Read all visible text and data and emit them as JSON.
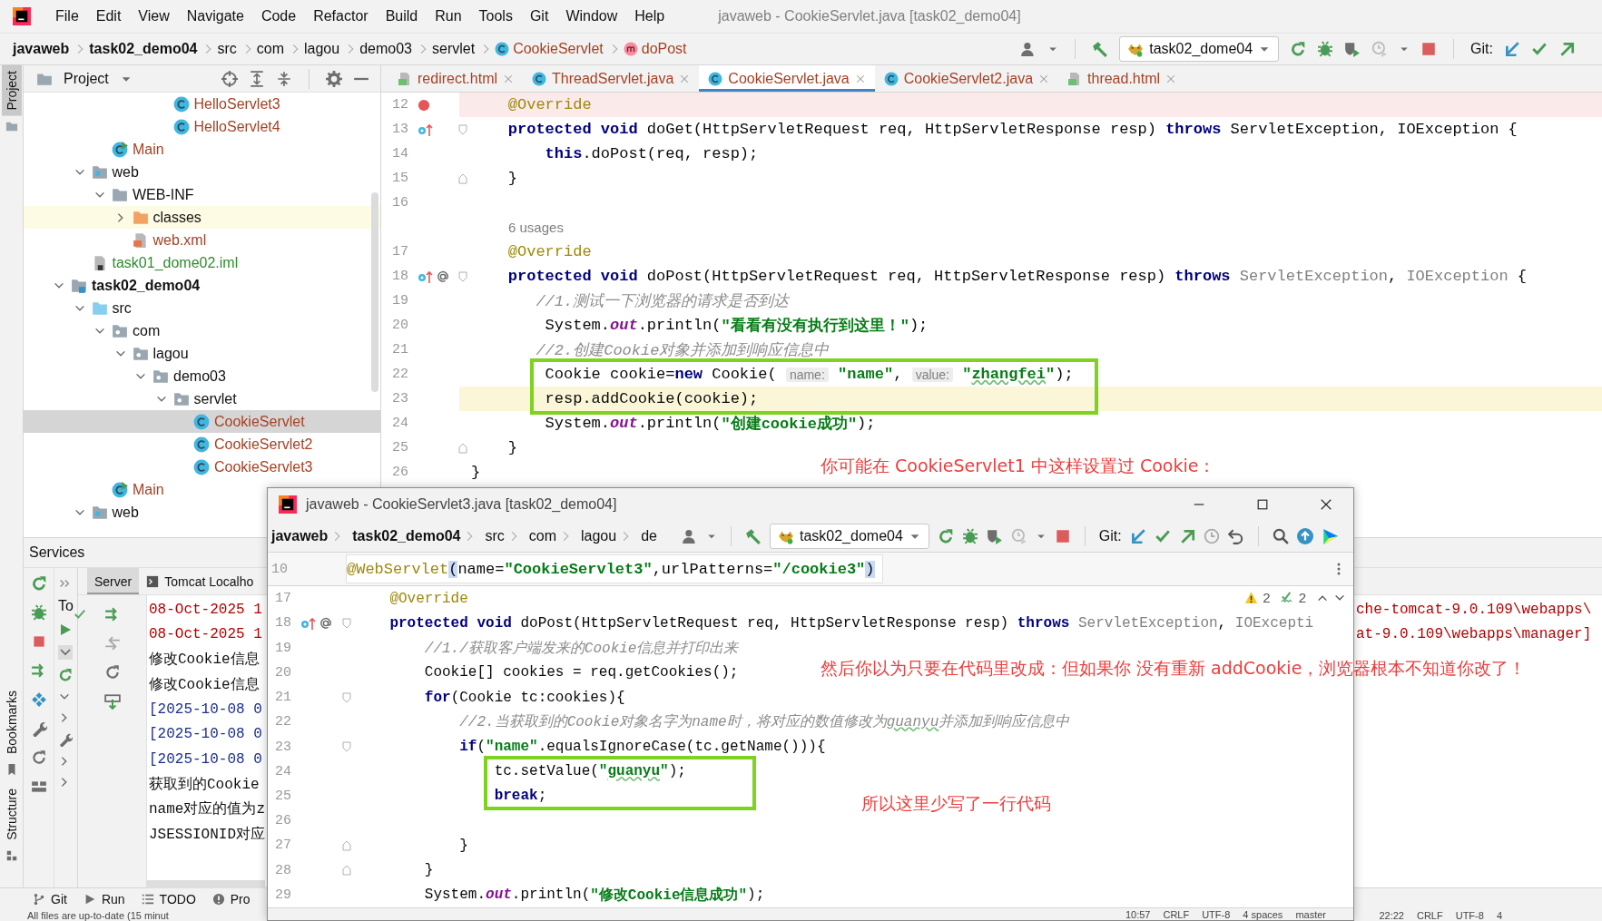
{
  "menu_bar": {
    "items": [
      "File",
      "Edit",
      "View",
      "Navigate",
      "Code",
      "Refactor",
      "Build",
      "Run",
      "Tools",
      "Git",
      "Window",
      "Help"
    ],
    "title": "javaweb - CookieServlet.java [task02_demo04]"
  },
  "nav_bar": {
    "breadcrumbs": [
      {
        "label": "javaweb",
        "kind": "project"
      },
      {
        "label": "task02_demo04",
        "kind": "module"
      },
      {
        "label": "src",
        "kind": "dir"
      },
      {
        "label": "com",
        "kind": "dir"
      },
      {
        "label": "lagou",
        "kind": "dir"
      },
      {
        "label": "demo03",
        "kind": "dir"
      },
      {
        "label": "servlet",
        "kind": "dir"
      },
      {
        "label": "CookieServlet",
        "kind": "class"
      },
      {
        "label": "doPost",
        "kind": "method"
      }
    ],
    "run_config": "task02_dome04",
    "git_label": "Git:"
  },
  "side_strip": {
    "top": [
      {
        "label": "Project",
        "selected": true
      }
    ],
    "bottom": [
      {
        "label": "Bookmarks",
        "selected": false
      },
      {
        "label": "Structure",
        "selected": false
      }
    ]
  },
  "project_panel": {
    "title": "Project",
    "tree": [
      {
        "children": [
          {
            "children": [
              {
                "children": [
                  {
                    "children": [
                      {
                        "children": [
                          {
                            "label": "HelloServlet3",
                            "kind": "class",
                            "color": "#a64124",
                            "selected": false,
                            "highlighted": false
                          },
                          {
                            "label": "HelloServlet4",
                            "kind": "class",
                            "color": "#a64124",
                            "selected": false,
                            "highlighted": false
                          }
                        ]
                      }
                    ]
                  }
                ]
              },
              {
                "label": "Main",
                "kind": "main",
                "color": "#a64124",
                "selected": false,
                "highlighted": false
              }
            ]
          },
          {
            "label": "web",
            "kind": "web-folder",
            "color": "#111111",
            "expanded": true,
            "selected": false,
            "highlighted": false,
            "children": [
              {
                "label": "WEB-INF",
                "kind": "folder",
                "color": "#111111",
                "expanded": true,
                "selected": false,
                "highlighted": false,
                "children": [
                  {
                    "label": "classes",
                    "kind": "excluded-folder",
                    "color": "#111111",
                    "expanded": false,
                    "selected": false,
                    "highlighted": true
                  },
                  {
                    "label": "web.xml",
                    "kind": "xml",
                    "color": "#a64124",
                    "selected": false,
                    "highlighted": false
                  }
                ]
              }
            ]
          },
          {
            "label": "task01_dome02.iml",
            "kind": "iml",
            "color": "#2e8b2e",
            "selected": false,
            "highlighted": false
          }
        ]
      },
      {
        "label": "task02_demo04",
        "kind": "module",
        "color": "#111111",
        "expanded": true,
        "selected": false,
        "highlighted": false,
        "children": [
          {
            "label": "src",
            "kind": "source-folder",
            "color": "#111111",
            "expanded": true,
            "selected": false,
            "highlighted": false,
            "children": [
              {
                "label": "com",
                "kind": "package",
                "color": "#111111",
                "expanded": true,
                "selected": false,
                "highlighted": false,
                "children": [
                  {
                    "label": "lagou",
                    "kind": "package",
                    "color": "#111111",
                    "expanded": true,
                    "selected": false,
                    "highlighted": false,
                    "children": [
                      {
                        "label": "demo03",
                        "kind": "package",
                        "color": "#111111",
                        "expanded": true,
                        "selected": false,
                        "highlighted": false,
                        "children": [
                          {
                            "label": "servlet",
                            "kind": "package",
                            "color": "#111111",
                            "expanded": true,
                            "selected": false,
                            "highlighted": false,
                            "children": [
                              {
                                "label": "CookieServlet",
                                "kind": "class",
                                "color": "#a64124",
                                "selected": true,
                                "highlighted": false
                              },
                              {
                                "label": "CookieServlet2",
                                "kind": "class",
                                "color": "#a64124",
                                "selected": false,
                                "highlighted": false
                              },
                              {
                                "label": "CookieServlet3",
                                "kind": "class",
                                "color": "#a64124",
                                "selected": false,
                                "highlighted": false
                              }
                            ]
                          }
                        ]
                      }
                    ]
                  }
                ]
              },
              {
                "label": "Main",
                "kind": "main",
                "color": "#a64124",
                "selected": false,
                "highlighted": false
              }
            ]
          },
          {
            "label": "web",
            "kind": "web-folder",
            "color": "#111111",
            "expanded": true,
            "selected": false,
            "highlighted": false
          }
        ]
      }
    ]
  },
  "editor": {
    "tabs": [
      {
        "label": "redirect.html",
        "kind": "html",
        "selected": false
      },
      {
        "label": "ThreadServlet.java",
        "kind": "class",
        "selected": false
      },
      {
        "label": "CookieServlet.java",
        "kind": "class",
        "selected": true
      },
      {
        "label": "CookieServlet2.java",
        "kind": "class",
        "selected": false
      },
      {
        "label": "thread.html",
        "kind": "html",
        "selected": false
      }
    ],
    "lines": [
      {
        "kind": "code",
        "number": "12",
        "gutter": [
          {
            "kind": "breakpoint"
          }
        ],
        "current": false,
        "tokens": [
          {
            "kind": "ann",
            "text": "    @Override"
          }
        ]
      },
      {
        "kind": "code",
        "number": "13",
        "gutter": [
          {
            "kind": "override"
          }
        ],
        "fold": {
          "kind": "start"
        },
        "current": false,
        "tokens": [
          {
            "kind": "kw",
            "text": "    protected void "
          },
          {
            "kind": "p",
            "text": "doGet(HttpServletRequest req, HttpServletResponse resp) "
          },
          {
            "kind": "kw",
            "text": "throws "
          },
          {
            "kind": "p",
            "text": "ServletException, IOException {"
          }
        ]
      },
      {
        "kind": "code",
        "number": "14",
        "current": false,
        "tokens": [
          {
            "kind": "kw",
            "text": "        this"
          },
          {
            "kind": "p",
            "text": ".doPost(req, resp);"
          }
        ]
      },
      {
        "kind": "code",
        "number": "15",
        "fold": {
          "kind": "end"
        },
        "current": false,
        "tokens": [
          {
            "kind": "p",
            "text": "    }"
          }
        ]
      },
      {
        "kind": "code",
        "number": "16",
        "current": false
      },
      {
        "kind": "usages",
        "text": "6 usages",
        "current": false
      },
      {
        "kind": "code",
        "number": "17",
        "current": false,
        "tokens": [
          {
            "kind": "ann",
            "text": "    @Override"
          }
        ]
      },
      {
        "kind": "code",
        "number": "18",
        "gutter": [
          {
            "kind": "override"
          },
          {
            "kind": "annotation"
          }
        ],
        "fold": {
          "kind": "start"
        },
        "current": false,
        "tokens": [
          {
            "kind": "kw",
            "text": "    protected void "
          },
          {
            "kind": "p",
            "text": "doPost(HttpServletRequest req, HttpServletResponse resp) "
          },
          {
            "kind": "kw",
            "text": "throws "
          },
          {
            "kind": "dim",
            "text": "ServletException"
          },
          {
            "kind": "p",
            "text": ", "
          },
          {
            "kind": "dim",
            "text": "IOException"
          },
          {
            "kind": "p",
            "text": " {"
          }
        ]
      },
      {
        "kind": "code",
        "number": "19",
        "current": false,
        "tokens": [
          {
            "kind": "cm",
            "text": "       //1.测试一下浏览器的请求是否到达"
          }
        ]
      },
      {
        "kind": "code",
        "number": "20",
        "current": false,
        "tokens": [
          {
            "kind": "p",
            "text": "        System."
          },
          {
            "kind": "field",
            "text": "out"
          },
          {
            "kind": "p",
            "text": ".println("
          },
          {
            "kind": "str",
            "text": "\"看看有没有执行到这里！\""
          },
          {
            "kind": "p",
            "text": ");"
          }
        ]
      },
      {
        "kind": "code",
        "number": "21",
        "current": false,
        "tokens": [
          {
            "kind": "cm",
            "text": "       //2.创建Cookie对象并添加到响应信息中"
          }
        ]
      },
      {
        "kind": "code",
        "number": "22",
        "current": false,
        "tokens": [
          {
            "kind": "p",
            "text": "        Cookie cookie="
          },
          {
            "kind": "kw",
            "text": "new "
          },
          {
            "kind": "p",
            "text": "Cookie( "
          },
          {
            "kind": "hint",
            "text": "name:"
          },
          {
            "kind": "str",
            "text": " \"name\""
          },
          {
            "kind": "p",
            "text": ", "
          },
          {
            "kind": "hint",
            "text": "value:"
          },
          {
            "kind": "str",
            "text": " \""
          },
          {
            "kind": "typo",
            "text": "zhangfei"
          },
          {
            "kind": "str",
            "text": "\""
          },
          {
            "kind": "p",
            "text": ");"
          }
        ]
      },
      {
        "kind": "code",
        "number": "23",
        "current": true,
        "tokens": [
          {
            "kind": "p",
            "text": "        resp.addCookie(cookie);"
          }
        ]
      },
      {
        "kind": "code",
        "number": "24",
        "current": false,
        "tokens": [
          {
            "kind": "p",
            "text": "        System."
          },
          {
            "kind": "field",
            "text": "out"
          },
          {
            "kind": "p",
            "text": ".println("
          },
          {
            "kind": "str",
            "text": "\"创建cookie成功\""
          },
          {
            "kind": "p",
            "text": ");"
          }
        ]
      },
      {
        "kind": "code",
        "number": "25",
        "fold": {
          "kind": "end"
        },
        "current": false,
        "tokens": [
          {
            "kind": "p",
            "text": "    }"
          }
        ]
      },
      {
        "kind": "code",
        "number": "26",
        "current": false,
        "tokens": [
          {
            "kind": "p",
            "text": "}"
          }
        ]
      }
    ]
  },
  "services": {
    "title": "Services",
    "tabs": [
      {
        "label": "Server",
        "selected": true
      },
      {
        "label": "Tomcat Localho",
        "selected": false
      }
    ],
    "tree_item": "To",
    "console": [
      {
        "kind": "err",
        "text": "08-Oct-2025 1",
        "tail": "che-tomcat-9.0.109\\webapps\\"
      },
      {
        "kind": "err",
        "text": "08-Oct-2025 1",
        "tail": "at-9.0.109\\webapps\\manager]"
      },
      {
        "kind": "out",
        "text": "修改Cookie信息"
      },
      {
        "kind": "out",
        "text": "修改Cookie信息"
      },
      {
        "kind": "info",
        "text": "[2025-10-08 0"
      },
      {
        "kind": "info",
        "text": "[2025-10-08 0"
      },
      {
        "kind": "info",
        "text": "[2025-10-08 0"
      },
      {
        "kind": "out",
        "text": "获取到的Cookie"
      },
      {
        "kind": "out",
        "text": "name对应的值为z"
      },
      {
        "kind": "out",
        "text": "JSESSIONID对应"
      }
    ]
  },
  "bottom_tools": [
    {
      "label": "Git",
      "kind": "git"
    },
    {
      "label": "Run",
      "kind": "run"
    },
    {
      "label": "TODO",
      "kind": "todo"
    },
    {
      "label": "Pro",
      "kind": "problems"
    }
  ],
  "status_bar": {
    "message": "All files are up-to-date (15 minut",
    "items": [
      "22:22",
      "CRLF",
      "UTF-8",
      "4"
    ]
  },
  "float_window": {
    "title": "javaweb - CookieServlet3.java [task02_demo04]",
    "breadcrumbs": [
      {
        "label": "javaweb",
        "kind": "project"
      },
      {
        "label": "task02_demo04",
        "kind": "module"
      },
      {
        "label": "src",
        "kind": "dir"
      },
      {
        "label": "com",
        "kind": "dir"
      },
      {
        "label": "lagou",
        "kind": "dir"
      },
      {
        "label": "de",
        "kind": "dir"
      }
    ],
    "run_config": "task02_dome04",
    "git_label": "Git:",
    "sticky_line": {
      "number": "10",
      "tokens": [
        {
          "kind": "ann",
          "text": "@WebServlet"
        },
        {
          "kind": "brace",
          "text": "("
        },
        {
          "kind": "p",
          "text": "name="
        },
        {
          "kind": "str",
          "text": "\"CookieServlet3\""
        },
        {
          "kind": "p",
          "text": ",urlPatterns="
        },
        {
          "kind": "str",
          "text": "\"/cookie3\""
        },
        {
          "kind": "brace",
          "text": ")"
        }
      ]
    },
    "inspections": {
      "warnings": "2",
      "checks": "2"
    },
    "lines": [
      {
        "kind": "code",
        "number": "17",
        "tokens": [
          {
            "kind": "ann",
            "text": "    @Override"
          }
        ]
      },
      {
        "kind": "code",
        "number": "18",
        "gutter": [
          {
            "kind": "override"
          },
          {
            "kind": "annotation"
          }
        ],
        "fold": {
          "kind": "start"
        },
        "tokens": [
          {
            "kind": "kw",
            "text": "    protected void "
          },
          {
            "kind": "p",
            "text": "doPost(HttpServletRequest req, HttpServletResponse resp) "
          },
          {
            "kind": "kw",
            "text": "throws "
          },
          {
            "kind": "dim",
            "text": "ServletException"
          },
          {
            "kind": "p",
            "text": ", "
          },
          {
            "kind": "dim",
            "text": "IOExcepti"
          }
        ]
      },
      {
        "kind": "code",
        "number": "19",
        "tokens": [
          {
            "kind": "cm",
            "text": "        //1./获取客户端发来的Cookie信息并打印出来"
          }
        ]
      },
      {
        "kind": "code",
        "number": "20",
        "tokens": [
          {
            "kind": "p",
            "text": "        Cookie[] cookies = req.getCookies();"
          }
        ]
      },
      {
        "kind": "code",
        "number": "21",
        "fold": {
          "kind": "start"
        },
        "tokens": [
          {
            "kind": "kw",
            "text": "        for"
          },
          {
            "kind": "p",
            "text": "(Cookie tc:cookies){"
          }
        ]
      },
      {
        "kind": "code",
        "number": "22",
        "tokens": [
          {
            "kind": "cm",
            "text": "            //2.当获取到的Cookie对象名字为name时，将对应的数值修改为"
          },
          {
            "kind": "cm-typo",
            "text": "guanyu"
          },
          {
            "kind": "cm",
            "text": "并添加到响应信息中"
          }
        ]
      },
      {
        "kind": "code",
        "number": "23",
        "fold": {
          "kind": "start"
        },
        "tokens": [
          {
            "kind": "kw",
            "text": "            if"
          },
          {
            "kind": "p",
            "text": "("
          },
          {
            "kind": "str",
            "text": "\"name\""
          },
          {
            "kind": "p",
            "text": ".equalsIgnoreCase(tc.getName())){"
          }
        ]
      },
      {
        "kind": "code",
        "number": "24",
        "tokens": [
          {
            "kind": "p",
            "text": "                tc.setValue("
          },
          {
            "kind": "str",
            "text": "\""
          },
          {
            "kind": "typo",
            "text": "guanyu"
          },
          {
            "kind": "str",
            "text": "\""
          },
          {
            "kind": "p",
            "text": ");"
          }
        ]
      },
      {
        "kind": "code",
        "number": "25",
        "tokens": [
          {
            "kind": "kw",
            "text": "                break"
          },
          {
            "kind": "p",
            "text": ";"
          }
        ]
      },
      {
        "kind": "code",
        "number": "26"
      },
      {
        "kind": "code",
        "number": "27",
        "fold": {
          "kind": "end"
        },
        "tokens": [
          {
            "kind": "p",
            "text": "            }"
          }
        ]
      },
      {
        "kind": "code",
        "number": "28",
        "fold": {
          "kind": "end"
        },
        "tokens": [
          {
            "kind": "p",
            "text": "        }"
          }
        ]
      },
      {
        "kind": "code",
        "number": "29",
        "tokens": [
          {
            "kind": "p",
            "text": "        System."
          },
          {
            "kind": "field",
            "text": "out"
          },
          {
            "kind": "p",
            "text": ".println("
          },
          {
            "kind": "str",
            "text": "\"修改Cookie信息成功\""
          },
          {
            "kind": "p",
            "text": ");"
          }
        ]
      }
    ],
    "status_bar": [
      "10:57",
      "CRLF",
      "UTF-8",
      "4 spaces",
      "master"
    ]
  },
  "annotations": [
    {
      "text": "你可能在 CookieServlet1 中这样设置过 Cookie："
    },
    {
      "text": "然后你以为只要在代码里改成：但如果你 没有重新 addCookie，浏览器根本不知道你改了！"
    },
    {
      "text": "所以这里少写了一行代码"
    }
  ]
}
